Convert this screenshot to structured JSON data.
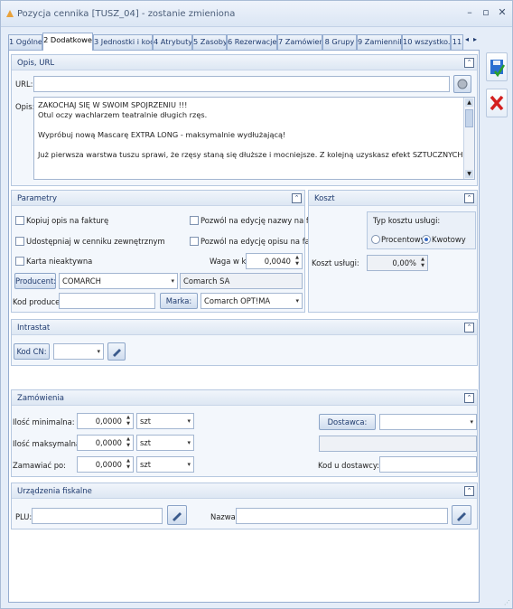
{
  "window": {
    "title": "Pozycja cennika [TUSZ_04] - zostanie zmieniona",
    "minimize": "–",
    "restore": "▫",
    "close": "✕"
  },
  "tabs": [
    "1 Ogólne",
    "2 Dodatkowe",
    "3 Jednostki i kody",
    "4 Atrybuty",
    "5 Zasoby",
    "6 Rezerwacje",
    "7 Zamówienia",
    "8 Grupy",
    "9 Zamienniki",
    "10 wszystko.pl",
    "11"
  ],
  "tab_nav": {
    "left": "◂",
    "right": "▸"
  },
  "opis_url": {
    "header": "Opis, URL",
    "url_label": "URL:",
    "url_value": "",
    "opis_label": "Opis:",
    "opis_lines": [
      "ZAKOCHAJ SIĘ W SWOIM SPOJRZENIU !!!",
      "Otul oczy wachlarzem teatralnie długich rzęs.",
      "",
      "Wypróbuj nową Mascarę EXTRA LONG - maksymalnie wydłużającą!",
      "",
      "Już pierwsza warstwa tuszu sprawi, że rzęsy staną się dłuższe i mocniejsze. Z kolejną uzyskasz efekt SZTUCZNYCH RZĘS!"
    ]
  },
  "parametry": {
    "header": "Parametry",
    "kopiuj": "Kopiuj opis na fakturę",
    "udostepniaj": "Udostępniaj w cenniku zewnętrznym",
    "karta": "Karta nieaktywna",
    "pozwol_nazwa": "Pozwól na edycję nazwy na fakturze",
    "pozwol_opis": "Pozwól na edycję opisu na fakturze",
    "waga_label": "Waga w kg:",
    "waga_value": "0,0040",
    "producent_btn": "Producent:",
    "producent_value": "COMARCH",
    "producent_name": "Comarch SA",
    "kod_producenta_label": "Kod producenta",
    "kod_producenta_value": "",
    "marka_btn": "Marka:",
    "marka_value": "Comarch OPT!MA"
  },
  "koszt": {
    "header": "Koszt",
    "typ_label": "Typ kosztu usługi:",
    "procentowy": "Procentowy",
    "kwotowy": "Kwotowy",
    "koszt_uslugi_label": "Koszt usługi:",
    "koszt_uslugi_value": "0,00%"
  },
  "intrastat": {
    "header": "Intrastat",
    "kod_cn_btn": "Kod CN:",
    "kod_cn_value": ""
  },
  "zamowienia": {
    "header": "Zamówienia",
    "min_label": "Ilość minimalna:",
    "min_value": "0,0000",
    "min_unit": "szt",
    "max_label": "Ilość maksymalna:",
    "max_value": "0,0000",
    "max_unit": "szt",
    "po_label": "Zamawiać po:",
    "po_value": "0,0000",
    "po_unit": "szt",
    "dostawca_btn": "Dostawca:",
    "dostawca_value": "",
    "kod_dostawcy_label": "Kod u dostawcy:",
    "kod_dostawcy_value": ""
  },
  "fiskalne": {
    "header": "Urządzenia fiskalne",
    "plu_label": "PLU:",
    "plu_value": "",
    "nazwa_label": "Nazwa:",
    "nazwa_value": ""
  },
  "colors": {
    "accent": "#1e3a6e",
    "save": "#2a6fd1",
    "cancel": "#d42020"
  }
}
